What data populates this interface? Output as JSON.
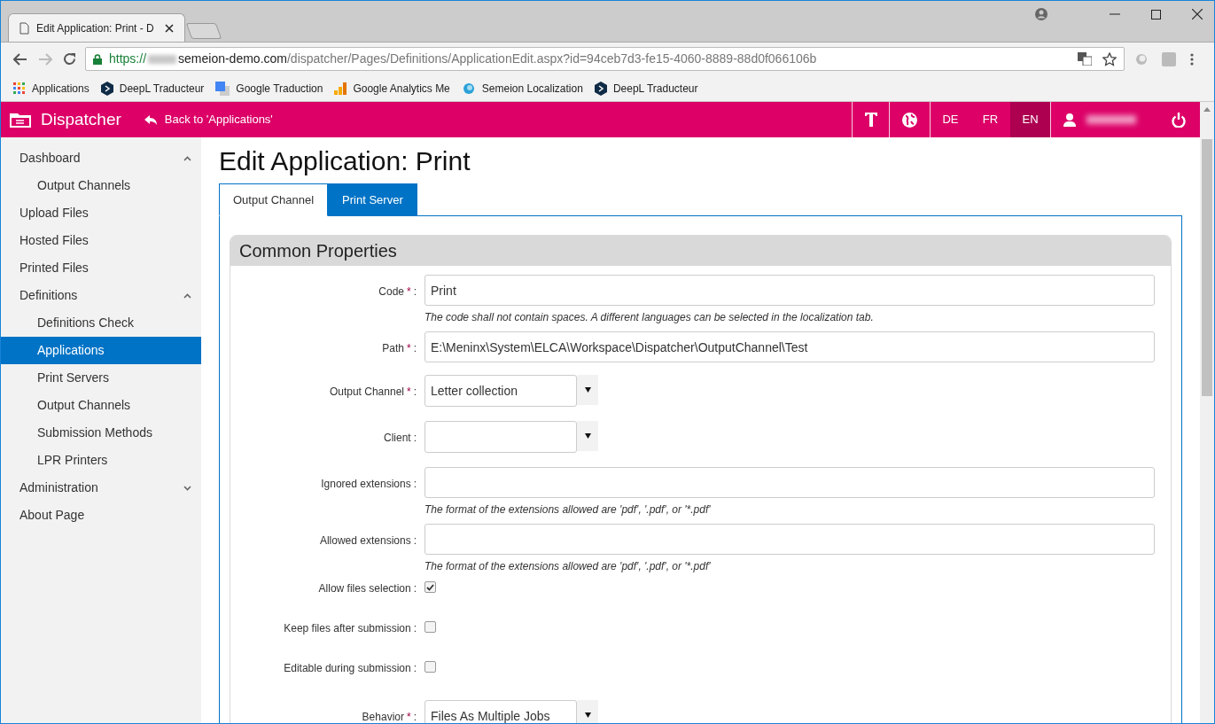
{
  "browser": {
    "tab_title": "Edit Application: Print - D",
    "url_scheme": "https://",
    "url_host": "semeion-demo.com",
    "url_path": "/dispatcher/Pages/Definitions/ApplicationEdit.aspx?id=94ceb7d3-fe15-4060-8889-88d0f066106b"
  },
  "bookmarks": [
    {
      "label": "Applications",
      "kind": "apps"
    },
    {
      "label": "DeepL Traducteur",
      "kind": "deepl"
    },
    {
      "label": "Google Traduction",
      "kind": "translate"
    },
    {
      "label": "Google Analytics Me",
      "kind": "analytics"
    },
    {
      "label": "Semeion Localization",
      "kind": "semeion"
    },
    {
      "label": "DeepL Traducteur",
      "kind": "deepl"
    }
  ],
  "app_bar": {
    "title": "Dispatcher",
    "back_link": "Back to 'Applications'",
    "languages": [
      {
        "label": "DE",
        "selected": false
      },
      {
        "label": "FR",
        "selected": false
      },
      {
        "label": "EN",
        "selected": true
      }
    ]
  },
  "sidebar": {
    "items": [
      {
        "label": "Dashboard",
        "selected": false,
        "expanded": true,
        "children": [
          {
            "label": "Output Channels",
            "selected": false
          }
        ]
      },
      {
        "label": "Upload Files",
        "selected": false
      },
      {
        "label": "Hosted Files",
        "selected": false
      },
      {
        "label": "Printed Files",
        "selected": false
      },
      {
        "label": "Definitions",
        "selected": false,
        "expanded": true,
        "children": [
          {
            "label": "Definitions Check",
            "selected": false
          },
          {
            "label": "Applications",
            "selected": true
          },
          {
            "label": "Print Servers",
            "selected": false
          },
          {
            "label": "Output Channels",
            "selected": false
          },
          {
            "label": "Submission Methods",
            "selected": false
          },
          {
            "label": "LPR Printers",
            "selected": false
          }
        ]
      },
      {
        "label": "Administration",
        "selected": false,
        "expanded": false
      },
      {
        "label": "About Page",
        "selected": false
      }
    ]
  },
  "page_title": "Edit Application: Print",
  "tabs": [
    {
      "label": "Output Channel",
      "selected": true
    },
    {
      "label": "Print Server",
      "selected": false
    }
  ],
  "section": {
    "title": "Common Properties",
    "fields": [
      {
        "kind": "text",
        "label": "Code",
        "required_mark": "*",
        "separator": ":",
        "value": "Print",
        "hint": "The code shall not contain spaces. A different languages can be selected in the localization tab."
      },
      {
        "kind": "text",
        "label": "Path",
        "required_mark": "*",
        "separator": ":",
        "value": "E:\\Meninx\\System\\ELCA\\Workspace\\Dispatcher\\OutputChannel\\Test"
      },
      {
        "kind": "select",
        "label": "Output Channel",
        "required_mark": "*",
        "separator": ":",
        "value": "Letter collection"
      },
      {
        "kind": "select",
        "label": "Client",
        "separator": ":"
      },
      {
        "kind": "text",
        "label": "Ignored extensions",
        "separator": ":",
        "hint": "The format of the extensions allowed are 'pdf', '.pdf', or '*.pdf'"
      },
      {
        "kind": "text",
        "label": "Allowed extensions",
        "separator": ":",
        "hint": "The format of the extensions allowed are 'pdf', '.pdf', or '*.pdf'"
      },
      {
        "kind": "checkbox",
        "label": "Allow files selection",
        "separator": ":",
        "checked": true
      },
      {
        "kind": "checkbox",
        "label": "Keep files after submission",
        "separator": ":",
        "checked": false
      },
      {
        "kind": "checkbox",
        "label": "Editable during submission",
        "separator": ":",
        "checked": false
      },
      {
        "kind": "select",
        "label": "Behavior",
        "required_mark": "*",
        "separator": ":",
        "value": "Files As Multiple Jobs"
      }
    ]
  }
}
